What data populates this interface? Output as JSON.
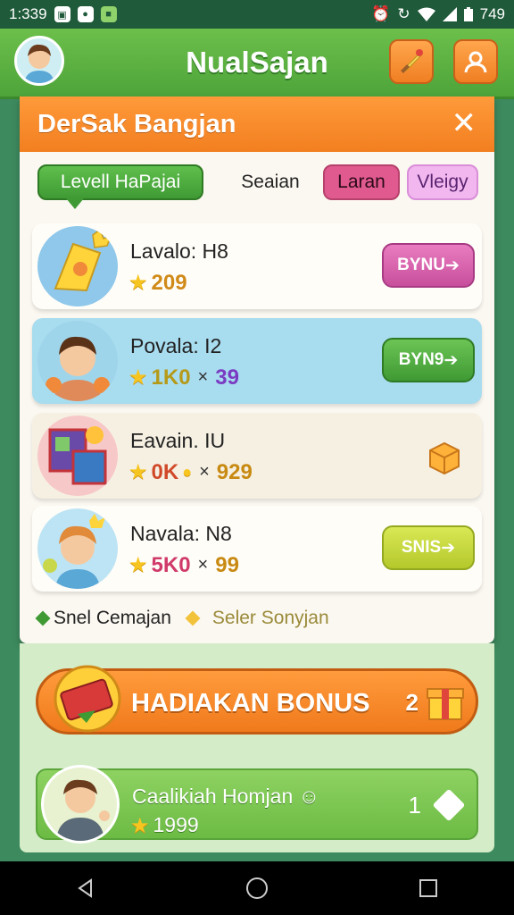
{
  "status_bar": {
    "time": "1:339",
    "battery": "749",
    "left_icons": [
      "image-notification-icon",
      "app-notification-icon",
      "game-notification-icon"
    ],
    "right_icons": [
      "alarm-icon",
      "sync-icon",
      "wifi-icon",
      "signal-icon",
      "battery-icon"
    ]
  },
  "app_bar": {
    "title": "NualSajan",
    "right_buttons": [
      "sword-icon",
      "profile-icon"
    ]
  },
  "sheet": {
    "title": "DerSak Bangjan",
    "close_icon": "close-icon",
    "filters": {
      "level_chip": "Levell HaPajai",
      "plain_chip": "Seaian",
      "pink_chip": "Laran",
      "lilac_chip": "Vleigy"
    },
    "rows": [
      {
        "name": "Lavalo: H8",
        "score": "209",
        "x_value": "",
        "button": "BYNU",
        "button_color": "#d8579f"
      },
      {
        "name": "Povala: I2",
        "score": "1K0",
        "x_value": "39",
        "button": "BYN9",
        "button_color": "#4fae3c"
      },
      {
        "name": "Eavain. IU",
        "score": "0K",
        "x_value": "929",
        "button": "",
        "button_color": ""
      },
      {
        "name": "Navala: N8",
        "score": "5K0",
        "x_value": "99",
        "button": "SNIS",
        "button_color": "#c4d638"
      }
    ],
    "footer": {
      "left_text": "Snel Cemajan",
      "right_text": "Seler Sonyjan",
      "left_icon": "green-diamond-icon",
      "right_icon": "yellow-diamond-icon"
    }
  },
  "bonus": {
    "label": "HADIAKAN BONUS",
    "count": "2"
  },
  "player": {
    "name": "Caalikiah Homjan",
    "score": "1999",
    "rank": "1"
  },
  "colors": {
    "app_green": "#5aae40",
    "accent_orange": "#f27f20",
    "sheet_bg": "#fbf8f1"
  }
}
